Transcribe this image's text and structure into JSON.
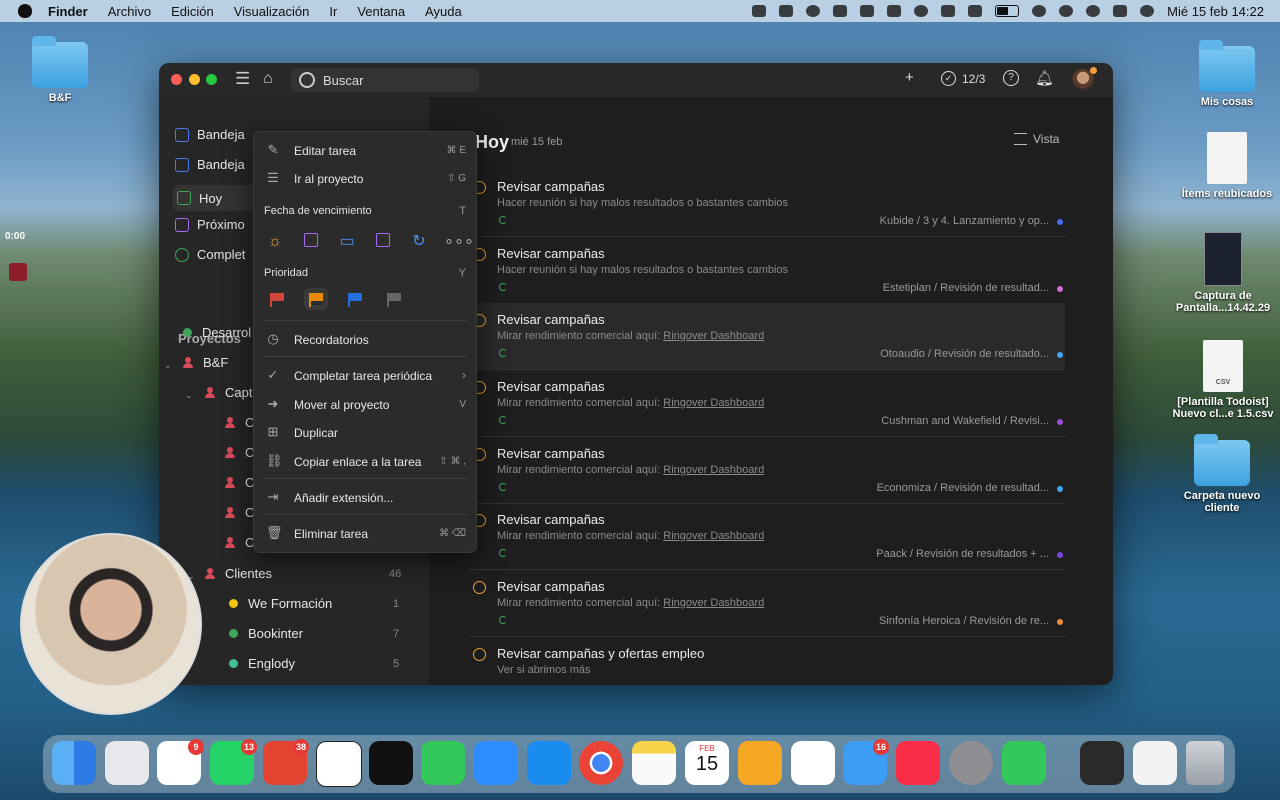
{
  "menubar": {
    "items": [
      "Finder",
      "Archivo",
      "Edición",
      "Visualización",
      "Ir",
      "Ventana",
      "Ayuda"
    ],
    "clock": "Mié 15 feb 14:22"
  },
  "desktop": {
    "bf_label": "B&F",
    "mis_cosas": "Mis cosas",
    "items_reubicados": "Ítems reubicados",
    "captura_1": "Captura de",
    "captura_2": "Pantalla...14.42.29",
    "plantilla_1": "[Plantilla Todoist]",
    "plantilla_2": "Nuevo cl...e 1.5.csv",
    "carpeta_1": "Carpeta nuevo",
    "carpeta_2": "cliente",
    "rec_time": "0:00"
  },
  "topbar": {
    "search_placeholder": "Buscar",
    "karma": "12/3"
  },
  "sidebar": {
    "nav": [
      "Bandeja",
      "Bandeja",
      "Hoy",
      "Próximo",
      "Complet"
    ],
    "projects_header": "Proyectos",
    "projects": [
      {
        "label": "Desarrol"
      },
      {
        "label": "B&F"
      },
      {
        "label": "Capt"
      },
      {
        "label": "C"
      },
      {
        "label": "C"
      },
      {
        "label": "C"
      },
      {
        "label": "C"
      },
      {
        "label": "C"
      },
      {
        "label": "Clientes",
        "count": "46"
      },
      {
        "label": "We Formación",
        "count": "1"
      },
      {
        "label": "Bookinter",
        "count": "7"
      },
      {
        "label": "Englody",
        "count": "5"
      }
    ]
  },
  "main": {
    "title": "Hoy",
    "date": "mié 15 feb",
    "view_label": "Vista",
    "tasks": [
      {
        "title": "Revisar campañas",
        "desc": "Hacer reunión si hay malos resultados o bastantes cambios",
        "link": "",
        "project": "Kubide / 3 y 4. Lanzamiento y op...",
        "color": "#4a6cf7"
      },
      {
        "title": "Revisar campañas",
        "desc": "Hacer reunión si hay malos resultados o bastantes cambios",
        "link": "",
        "project": "Estetiplan / Revisión de resultad...",
        "color": "#d56ad9"
      },
      {
        "title": "Revisar campañas",
        "desc": "Mirar rendimiento comercial aquí:",
        "link": "Ringover Dashboard",
        "project": "Otoaudio / Revisión de resultado...",
        "color": "#3fa9f5"
      },
      {
        "title": "Revisar campañas",
        "desc": "Mirar rendimiento comercial aquí:",
        "link": "Ringover Dashboard",
        "project": "Cushman and Wakefield / Revisi...",
        "color": "#9b4dde"
      },
      {
        "title": "Revisar campañas",
        "desc": "Mirar rendimiento comercial aquí:",
        "link": "Ringover Dashboard",
        "project": "Economiza / Revisión de resultad...",
        "color": "#3fa9f5"
      },
      {
        "title": "Revisar campañas",
        "desc": "Mirar rendimiento comercial aquí:",
        "link": "Ringover Dashboard",
        "project": "Paack / Revisión de resultados + ...",
        "color": "#7b3fe4"
      },
      {
        "title": "Revisar campañas",
        "desc": "Mirar rendimiento comercial aquí:",
        "link": "Ringover Dashboard",
        "project": "Sinfonía Heroica / Revisión de re...",
        "color": "#f58a3a"
      },
      {
        "title": "Revisar campañas y ofertas empleo",
        "desc": "Ver si abrimos más",
        "link": "",
        "project": "",
        "color": ""
      }
    ]
  },
  "context_menu": {
    "edit": {
      "label": "Editar tarea",
      "kbd": "⌘ E"
    },
    "goto": {
      "label": "Ir al proyecto",
      "kbd": "⇧ G"
    },
    "due_header": "Fecha de vencimiento",
    "due_key": "T",
    "priority_header": "Prioridad",
    "priority_key": "Y",
    "reminders": {
      "label": "Recordatorios"
    },
    "complete_recurring": {
      "label": "Completar tarea periódica"
    },
    "move": {
      "label": "Mover al proyecto",
      "kbd": "V"
    },
    "duplicate": {
      "label": "Duplicar"
    },
    "copy_link": {
      "label": "Copiar enlace a la tarea",
      "kbd": "⇧ ⌘ ,"
    },
    "extension": {
      "label": "Añadir extensión..."
    },
    "delete": {
      "label": "Eliminar tarea",
      "kbd": "⌘ ⌫"
    },
    "priority_colors": [
      "#d1453b",
      "#eb8909",
      "#246fe0",
      "#666666"
    ]
  },
  "dock": {
    "badges": {
      "slack": "9",
      "whatsapp": "13",
      "todoist": "38",
      "mail": "16"
    },
    "calendar_month": "FEB",
    "calendar_day": "15"
  }
}
